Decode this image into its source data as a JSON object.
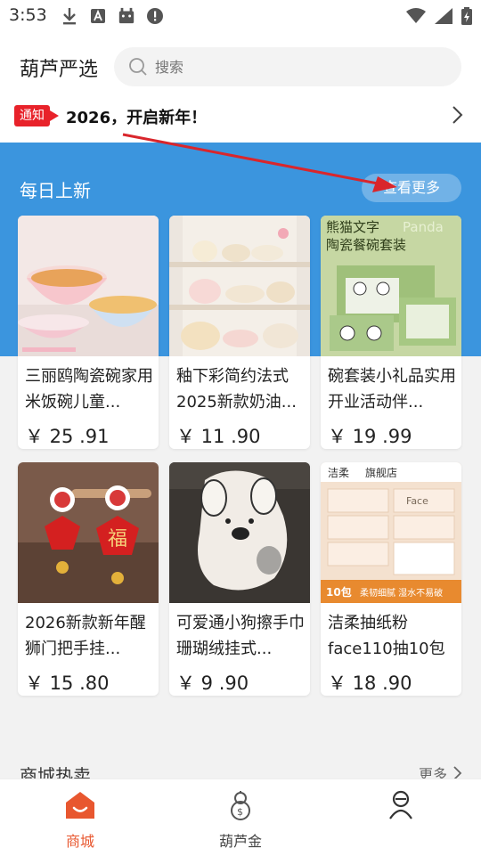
{
  "status_bar": {
    "time": "3:53",
    "icons": [
      "download-icon",
      "app-icon",
      "android-icon",
      "alert-icon"
    ],
    "right_icons": [
      "wifi-icon",
      "signal-icon",
      "battery-icon"
    ]
  },
  "header": {
    "brand": "葫芦严选",
    "search_placeholder": "搜索"
  },
  "notice": {
    "tag": "通知",
    "text": "2026，开启新年！"
  },
  "daily_new": {
    "title": "每日上新",
    "more_label": "查看更多"
  },
  "products": [
    {
      "title": "三丽鸥陶瓷碗家用米饭碗儿童...",
      "price": "￥ 25 .91"
    },
    {
      "title": "釉下彩简约法式2025新款奶油...",
      "price": "￥ 11 .90"
    },
    {
      "title": "碗套装小礼品实用开业活动伴...",
      "price": "￥ 19 .99"
    },
    {
      "title": "2026新款新年醒狮门把手挂...",
      "price": "￥ 15 .80"
    },
    {
      "title": "可爱通小狗擦手巾珊瑚绒挂式...",
      "price": "￥ 9 .90"
    },
    {
      "title": "洁柔抽纸粉face110抽10包纸...",
      "price": "￥ 18 .90"
    }
  ],
  "product_image_text": {
    "panda_title": "熊猫文字",
    "panda_sub": "陶瓷餐碗套装",
    "panda_brand": "Panda",
    "fu": "福",
    "tissue_brand": "洁柔",
    "tissue_store": "旗舰店",
    "tissue_face": "Face",
    "tissue_count": "10包",
    "tissue_slogan": "柔韧细腻 湿水不易破"
  },
  "hot": {
    "title": "商城热卖",
    "more_label": "更多"
  },
  "bottom_nav": [
    {
      "label": "商城",
      "icon": "home-icon",
      "active": true
    },
    {
      "label": "葫芦金",
      "icon": "gourd-icon",
      "active": false
    },
    {
      "label": "",
      "icon": "profile-icon",
      "active": false
    }
  ],
  "colors": {
    "accent": "#e8572f",
    "band": "#3b95de",
    "notice_tag": "#e8222a",
    "arrow": "#d9262c"
  }
}
